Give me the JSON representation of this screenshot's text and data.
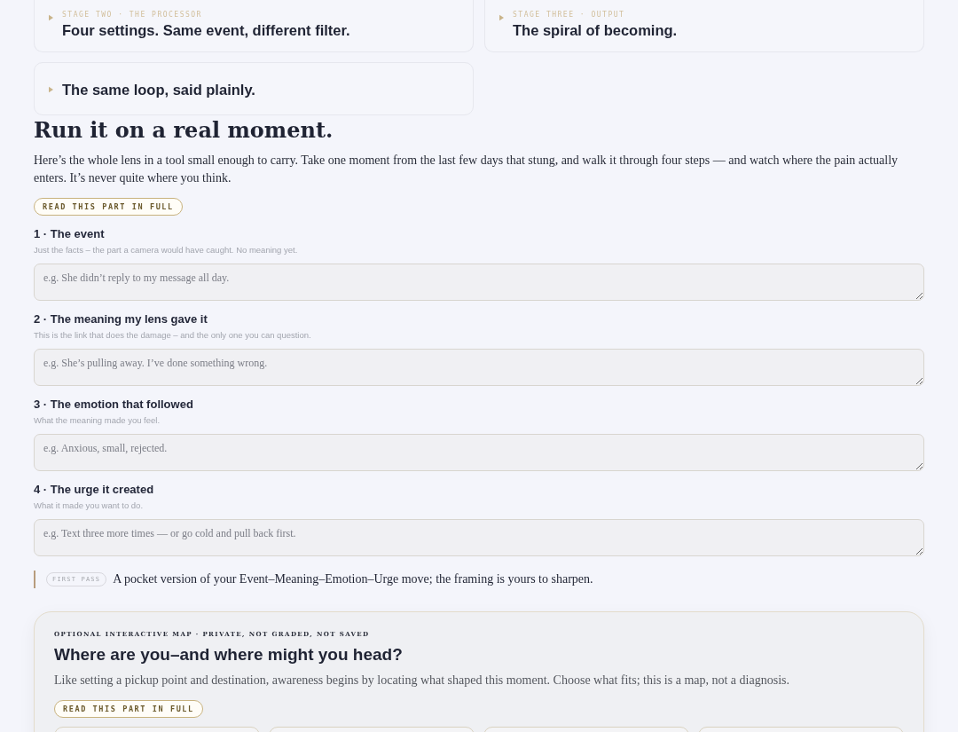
{
  "stages": [
    {
      "eyebrow": "STAGE TWO · THE PROCESSOR",
      "title": "Four settings. Same event, different filter.",
      "expanded": false
    },
    {
      "eyebrow": "STAGE THREE · OUTPUT",
      "title": "The spiral of becoming.",
      "expanded": false
    },
    {
      "title": "The same loop, said plainly.",
      "expanded": false
    }
  ],
  "section": {
    "heading": "Run it on a real moment.",
    "intro": "Here’s the whole lens in a tool small enough to carry. Take one moment from the last few days that stung, and walk it through four steps — and watch where the pain actually enters. It’s never quite where you think.",
    "read_button": "READ THIS PART IN FULL"
  },
  "steps": [
    {
      "label": "1 · The event",
      "hint": "Just the facts – the part a camera would have caught. No meaning yet.",
      "placeholder": "e.g. She didn’t reply to my message all day."
    },
    {
      "label": "2 · The meaning my lens gave it",
      "hint": "This is the link that does the damage – and the only one you can question.",
      "placeholder": "e.g. She’s pulling away. I’ve done something wrong."
    },
    {
      "label": "3 · The emotion that followed",
      "hint": "What the meaning made you feel.",
      "placeholder": "e.g. Anxious, small, rejected."
    },
    {
      "label": "4 · The urge it created",
      "hint": "What it made you want to do.",
      "placeholder": "e.g. Text three more times — or go cold and pull back first."
    }
  ],
  "note": {
    "tag": "FIRST PASS",
    "text": "A pocket version of your Event–Meaning–Emotion–Urge move; the framing is yours to sharpen."
  },
  "map": {
    "eyebrow": "OPTIONAL INTERACTIVE MAP · PRIVATE, NOT GRADED, NOT SAVED",
    "heading": "Where are you–and where might you head?",
    "intro": "Like setting a pickup point and destination, awareness begins by locating what shaped this moment. Choose what fits; this is a map, not a diagnosis.",
    "read_button": "READ THIS PART IN FULL"
  }
}
